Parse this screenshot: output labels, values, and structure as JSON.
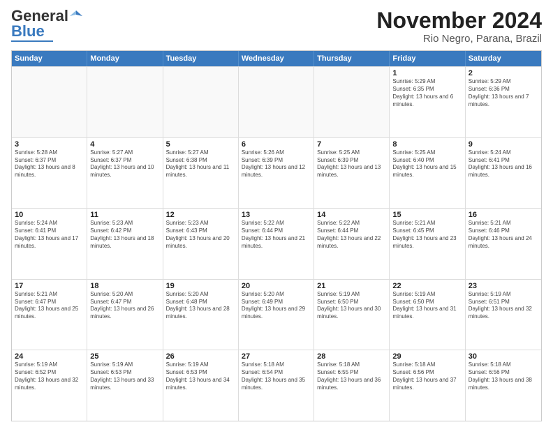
{
  "logo": {
    "general": "General",
    "blue": "Blue"
  },
  "title": "November 2024",
  "subtitle": "Rio Negro, Parana, Brazil",
  "header_days": [
    "Sunday",
    "Monday",
    "Tuesday",
    "Wednesday",
    "Thursday",
    "Friday",
    "Saturday"
  ],
  "rows": [
    [
      {
        "day": "",
        "info": "",
        "empty": true
      },
      {
        "day": "",
        "info": "",
        "empty": true
      },
      {
        "day": "",
        "info": "",
        "empty": true
      },
      {
        "day": "",
        "info": "",
        "empty": true
      },
      {
        "day": "",
        "info": "",
        "empty": true
      },
      {
        "day": "1",
        "info": "Sunrise: 5:29 AM\nSunset: 6:35 PM\nDaylight: 13 hours and 6 minutes."
      },
      {
        "day": "2",
        "info": "Sunrise: 5:29 AM\nSunset: 6:36 PM\nDaylight: 13 hours and 7 minutes."
      }
    ],
    [
      {
        "day": "3",
        "info": "Sunrise: 5:28 AM\nSunset: 6:37 PM\nDaylight: 13 hours and 8 minutes."
      },
      {
        "day": "4",
        "info": "Sunrise: 5:27 AM\nSunset: 6:37 PM\nDaylight: 13 hours and 10 minutes."
      },
      {
        "day": "5",
        "info": "Sunrise: 5:27 AM\nSunset: 6:38 PM\nDaylight: 13 hours and 11 minutes."
      },
      {
        "day": "6",
        "info": "Sunrise: 5:26 AM\nSunset: 6:39 PM\nDaylight: 13 hours and 12 minutes."
      },
      {
        "day": "7",
        "info": "Sunrise: 5:25 AM\nSunset: 6:39 PM\nDaylight: 13 hours and 13 minutes."
      },
      {
        "day": "8",
        "info": "Sunrise: 5:25 AM\nSunset: 6:40 PM\nDaylight: 13 hours and 15 minutes."
      },
      {
        "day": "9",
        "info": "Sunrise: 5:24 AM\nSunset: 6:41 PM\nDaylight: 13 hours and 16 minutes."
      }
    ],
    [
      {
        "day": "10",
        "info": "Sunrise: 5:24 AM\nSunset: 6:41 PM\nDaylight: 13 hours and 17 minutes."
      },
      {
        "day": "11",
        "info": "Sunrise: 5:23 AM\nSunset: 6:42 PM\nDaylight: 13 hours and 18 minutes."
      },
      {
        "day": "12",
        "info": "Sunrise: 5:23 AM\nSunset: 6:43 PM\nDaylight: 13 hours and 20 minutes."
      },
      {
        "day": "13",
        "info": "Sunrise: 5:22 AM\nSunset: 6:44 PM\nDaylight: 13 hours and 21 minutes."
      },
      {
        "day": "14",
        "info": "Sunrise: 5:22 AM\nSunset: 6:44 PM\nDaylight: 13 hours and 22 minutes."
      },
      {
        "day": "15",
        "info": "Sunrise: 5:21 AM\nSunset: 6:45 PM\nDaylight: 13 hours and 23 minutes."
      },
      {
        "day": "16",
        "info": "Sunrise: 5:21 AM\nSunset: 6:46 PM\nDaylight: 13 hours and 24 minutes."
      }
    ],
    [
      {
        "day": "17",
        "info": "Sunrise: 5:21 AM\nSunset: 6:47 PM\nDaylight: 13 hours and 25 minutes."
      },
      {
        "day": "18",
        "info": "Sunrise: 5:20 AM\nSunset: 6:47 PM\nDaylight: 13 hours and 26 minutes."
      },
      {
        "day": "19",
        "info": "Sunrise: 5:20 AM\nSunset: 6:48 PM\nDaylight: 13 hours and 28 minutes."
      },
      {
        "day": "20",
        "info": "Sunrise: 5:20 AM\nSunset: 6:49 PM\nDaylight: 13 hours and 29 minutes."
      },
      {
        "day": "21",
        "info": "Sunrise: 5:19 AM\nSunset: 6:50 PM\nDaylight: 13 hours and 30 minutes."
      },
      {
        "day": "22",
        "info": "Sunrise: 5:19 AM\nSunset: 6:50 PM\nDaylight: 13 hours and 31 minutes."
      },
      {
        "day": "23",
        "info": "Sunrise: 5:19 AM\nSunset: 6:51 PM\nDaylight: 13 hours and 32 minutes."
      }
    ],
    [
      {
        "day": "24",
        "info": "Sunrise: 5:19 AM\nSunset: 6:52 PM\nDaylight: 13 hours and 32 minutes."
      },
      {
        "day": "25",
        "info": "Sunrise: 5:19 AM\nSunset: 6:53 PM\nDaylight: 13 hours and 33 minutes."
      },
      {
        "day": "26",
        "info": "Sunrise: 5:19 AM\nSunset: 6:53 PM\nDaylight: 13 hours and 34 minutes."
      },
      {
        "day": "27",
        "info": "Sunrise: 5:18 AM\nSunset: 6:54 PM\nDaylight: 13 hours and 35 minutes."
      },
      {
        "day": "28",
        "info": "Sunrise: 5:18 AM\nSunset: 6:55 PM\nDaylight: 13 hours and 36 minutes."
      },
      {
        "day": "29",
        "info": "Sunrise: 5:18 AM\nSunset: 6:56 PM\nDaylight: 13 hours and 37 minutes."
      },
      {
        "day": "30",
        "info": "Sunrise: 5:18 AM\nSunset: 6:56 PM\nDaylight: 13 hours and 38 minutes."
      }
    ]
  ]
}
